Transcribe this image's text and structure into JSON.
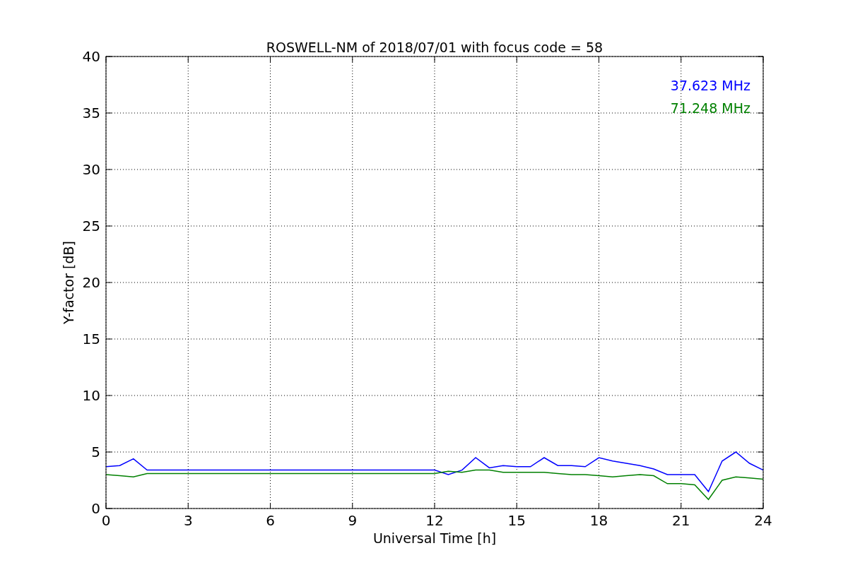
{
  "figure": {
    "chart_data": {
      "type": "line",
      "title": "ROSWELL-NM of 2018/07/01 with focus code = 58",
      "xlabel": "Universal Time [h]",
      "ylabel": "Y-factor [dB]",
      "x": [
        0,
        0.5,
        1,
        1.5,
        2,
        2.5,
        3,
        3.5,
        4,
        4.5,
        5,
        5.5,
        6,
        6.5,
        7,
        7.5,
        8,
        8.5,
        9,
        9.5,
        10,
        10.5,
        11,
        11.5,
        12,
        12.5,
        13,
        13.5,
        14,
        14.5,
        15,
        15.5,
        16,
        16.5,
        17,
        17.5,
        18,
        18.5,
        19,
        19.5,
        20,
        20.5,
        21,
        21.5,
        22,
        22.5,
        23,
        23.5,
        24
      ],
      "series": [
        {
          "name": "37.623 MHz",
          "color": "#0000ff",
          "values": [
            3.7,
            3.8,
            4.4,
            3.4,
            3.4,
            3.4,
            3.4,
            3.4,
            3.4,
            3.4,
            3.4,
            3.4,
            3.4,
            3.4,
            3.4,
            3.4,
            3.4,
            3.4,
            3.4,
            3.4,
            3.4,
            3.4,
            3.4,
            3.4,
            3.4,
            3.0,
            3.4,
            4.5,
            3.6,
            3.8,
            3.7,
            3.7,
            4.5,
            3.8,
            3.8,
            3.7,
            4.5,
            4.2,
            4.0,
            3.8,
            3.5,
            3.0,
            3.0,
            3.0,
            1.5,
            4.2,
            5.0,
            4.0,
            3.4
          ]
        },
        {
          "name": "71.248 MHz",
          "color": "#008000",
          "values": [
            3.0,
            2.9,
            2.8,
            3.1,
            3.1,
            3.1,
            3.1,
            3.1,
            3.1,
            3.1,
            3.1,
            3.1,
            3.1,
            3.1,
            3.1,
            3.1,
            3.1,
            3.1,
            3.1,
            3.1,
            3.1,
            3.1,
            3.1,
            3.1,
            3.1,
            3.3,
            3.2,
            3.4,
            3.4,
            3.2,
            3.2,
            3.2,
            3.2,
            3.1,
            3.0,
            3.0,
            2.9,
            2.8,
            2.9,
            3.0,
            2.9,
            2.2,
            2.2,
            2.1,
            0.8,
            2.5,
            2.8,
            2.7,
            2.6
          ]
        }
      ],
      "grid": true,
      "xlim": [
        0,
        24
      ],
      "ylim": [
        0,
        40
      ],
      "xticks": [
        0,
        3,
        6,
        9,
        12,
        15,
        18,
        21,
        24
      ],
      "yticks": [
        0,
        5,
        10,
        15,
        20,
        25,
        30,
        35,
        40
      ]
    }
  }
}
